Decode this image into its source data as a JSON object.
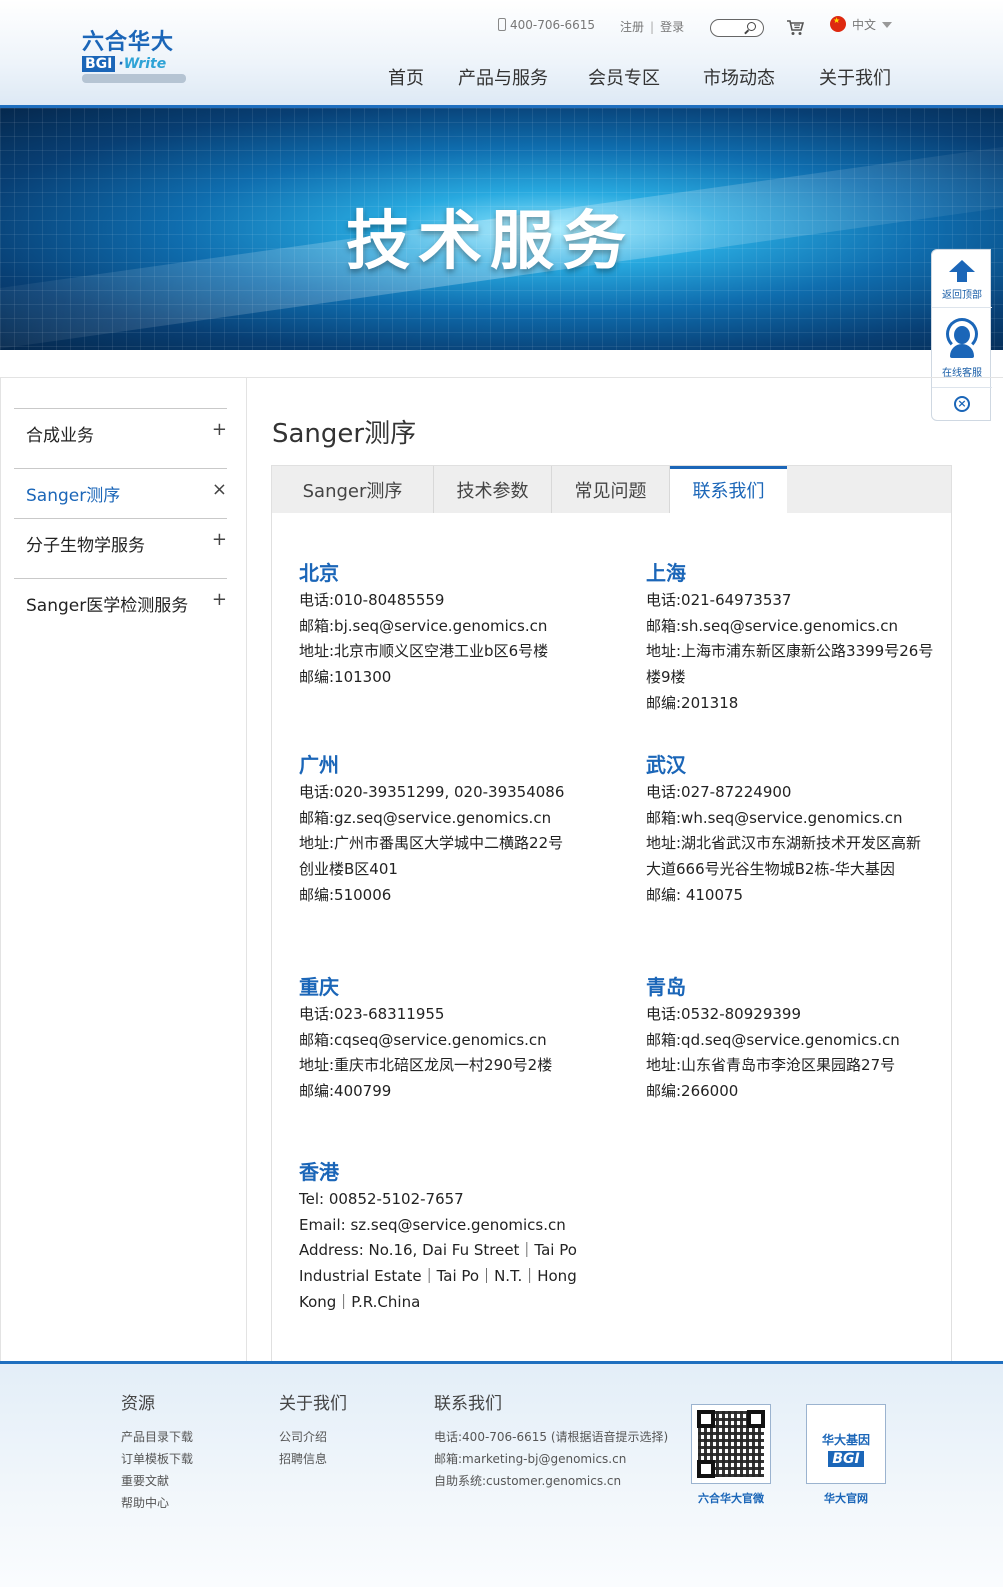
{
  "header": {
    "logo_cn": "六合华大",
    "logo_bgi": "BGI",
    "logo_write": "Write",
    "phone": "400-706-6615",
    "register": "注册",
    "login": "登录",
    "lang": "中文",
    "nav": [
      "首页",
      "产品与服务",
      "会员专区",
      "市场动态",
      "关于我们"
    ]
  },
  "banner": {
    "title": "技术服务"
  },
  "float": {
    "top": "返回顶部",
    "service": "在线客服"
  },
  "sidebar": {
    "items": [
      {
        "label": "合成业务",
        "sign": "+"
      },
      {
        "label": "Sanger测序",
        "sign": "×"
      },
      {
        "label": "分子生物学服务",
        "sign": "+"
      },
      {
        "label": "Sanger医学检测服务",
        "sign": "+"
      }
    ]
  },
  "main": {
    "title": "Sanger测序",
    "tabs": [
      "Sanger测序",
      "技术参数",
      "常见问题",
      "联系我们"
    ],
    "offices": [
      {
        "city": "北京",
        "lines": [
          "电话:010-80485559",
          "邮箱:bj.seq@service.genomics.cn",
          "地址:北京市顺义区空港工业b区6号楼",
          "邮编:101300"
        ]
      },
      {
        "city": "上海",
        "lines": [
          "电话:021-64973537",
          "邮箱:sh.seq@service.genomics.cn",
          "地址:上海市浦东新区康新公路3399号26号",
          "楼9楼",
          "邮编:201318"
        ]
      },
      {
        "city": "广州",
        "lines": [
          "电话:020-39351299, 020-39354086",
          "邮箱:gz.seq@service.genomics.cn",
          "地址:广州市番禺区大学城中二横路22号",
          "创业楼B区401",
          "邮编:510006"
        ]
      },
      {
        "city": "武汉",
        "lines": [
          "电话:027-87224900",
          "邮箱:wh.seq@service.genomics.cn",
          "地址:湖北省武汉市东湖新技术开发区高新",
          "大道666号光谷生物城B2栋-华大基因",
          "邮编: 410075"
        ]
      },
      {
        "city": "重庆",
        "lines": [
          "电话:023-68311955",
          "邮箱:cqseq@service.genomics.cn",
          "地址:重庆市北碚区龙凤一村290号2楼",
          "邮编:400799"
        ]
      },
      {
        "city": "青岛",
        "lines": [
          "电话:0532-80929399",
          "邮箱:qd.seq@service.genomics.cn",
          "地址:山东省青岛市李沧区果园路27号",
          "邮编:266000"
        ]
      },
      {
        "city": "香港",
        "lines": [
          "Tel: 00852-5102-7657",
          "Email:   sz.seq@service.genomics.cn",
          "Address: No.16, Dai Fu Street｜Tai Po",
          "Industrial Estate｜Tai Po｜N.T.｜Hong",
          "Kong｜P.R.China"
        ]
      }
    ]
  },
  "footer": {
    "resources": {
      "heading": "资源",
      "links": [
        "产品目录下载",
        "订单模板下载",
        "重要文献",
        "帮助中心"
      ]
    },
    "about": {
      "heading": "关于我们",
      "links": [
        "公司介绍",
        "招聘信息"
      ]
    },
    "contact": {
      "heading": "联系我们",
      "lines": [
        "电话:400-706-6615 (请根据语音提示选择)",
        "邮箱:marketing-bj@genomics.cn",
        "自助系统:customer.genomics.cn"
      ]
    },
    "qr_caption": "六合华大官微",
    "bgi_box": {
      "cn": "华大基因",
      "en": "BGI",
      "caption": "华大官网"
    }
  }
}
